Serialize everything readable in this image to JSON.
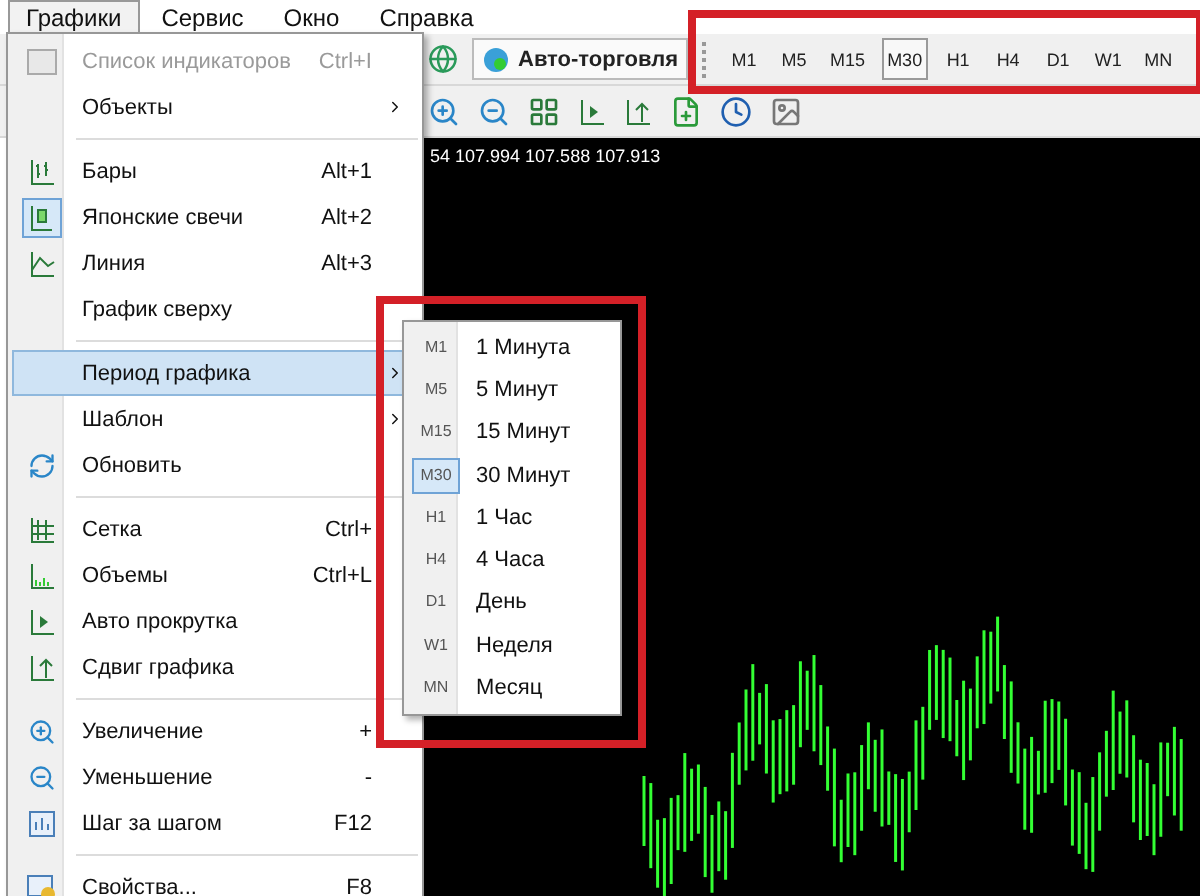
{
  "menubar": [
    {
      "label": "Графики",
      "selected": true
    },
    {
      "label": "Сервис",
      "selected": false
    },
    {
      "label": "Окно",
      "selected": false
    },
    {
      "label": "Справка",
      "selected": false
    }
  ],
  "toolbar": {
    "autotrade": "Авто-торговля",
    "timeframes": [
      {
        "label": "M1",
        "selected": false
      },
      {
        "label": "M5",
        "selected": false
      },
      {
        "label": "M15",
        "selected": false
      },
      {
        "label": "M30",
        "selected": true
      },
      {
        "label": "H1",
        "selected": false
      },
      {
        "label": "H4",
        "selected": false
      },
      {
        "label": "D1",
        "selected": false
      },
      {
        "label": "W1",
        "selected": false
      },
      {
        "label": "MN",
        "selected": false
      }
    ]
  },
  "chart": {
    "header": "54 107.994 107.588 107.913"
  },
  "menu": {
    "items": [
      {
        "kind": "item",
        "label": "Список индикаторов",
        "shortcut": "Ctrl+I",
        "disabled": true
      },
      {
        "kind": "item",
        "label": "Объекты",
        "submenu": true
      },
      {
        "kind": "separator"
      },
      {
        "kind": "item",
        "label": "Бары",
        "shortcut": "Alt+1"
      },
      {
        "kind": "item",
        "label": "Японские свечи",
        "shortcut": "Alt+2",
        "checked": true
      },
      {
        "kind": "item",
        "label": "Линия",
        "shortcut": "Alt+3"
      },
      {
        "kind": "item",
        "label": "График сверху"
      },
      {
        "kind": "separator"
      },
      {
        "kind": "item",
        "label": "Период графика",
        "submenu": true,
        "highlighted": true
      },
      {
        "kind": "item",
        "label": "Шаблон",
        "submenu": true
      },
      {
        "kind": "item",
        "label": "Обновить"
      },
      {
        "kind": "separator"
      },
      {
        "kind": "item",
        "label": "Сетка",
        "shortcut": "Ctrl+"
      },
      {
        "kind": "item",
        "label": "Объемы",
        "shortcut": "Ctrl+L"
      },
      {
        "kind": "item",
        "label": "Авто прокрутка"
      },
      {
        "kind": "item",
        "label": "Сдвиг графика"
      },
      {
        "kind": "separator"
      },
      {
        "kind": "item",
        "label": "Увеличение",
        "shortcut": "+"
      },
      {
        "kind": "item",
        "label": "Уменьшение",
        "shortcut": "-"
      },
      {
        "kind": "item",
        "label": "Шаг за шагом",
        "shortcut": "F12"
      },
      {
        "kind": "separator"
      },
      {
        "kind": "item",
        "label": "Свойства...",
        "shortcut": "F8"
      }
    ]
  },
  "submenu": {
    "items": [
      {
        "code": "M1",
        "label": "1 Минута",
        "selected": false
      },
      {
        "code": "M5",
        "label": "5 Минут",
        "selected": false
      },
      {
        "code": "M15",
        "label": "15 Минут",
        "selected": false
      },
      {
        "code": "M30",
        "label": "30 Минут",
        "selected": true
      },
      {
        "code": "H1",
        "label": "1 Час",
        "selected": false
      },
      {
        "code": "H4",
        "label": "4 Часа",
        "selected": false
      },
      {
        "code": "D1",
        "label": "День",
        "selected": false
      },
      {
        "code": "W1",
        "label": "Неделя",
        "selected": false
      },
      {
        "code": "MN",
        "label": "Месяц",
        "selected": false
      }
    ]
  }
}
